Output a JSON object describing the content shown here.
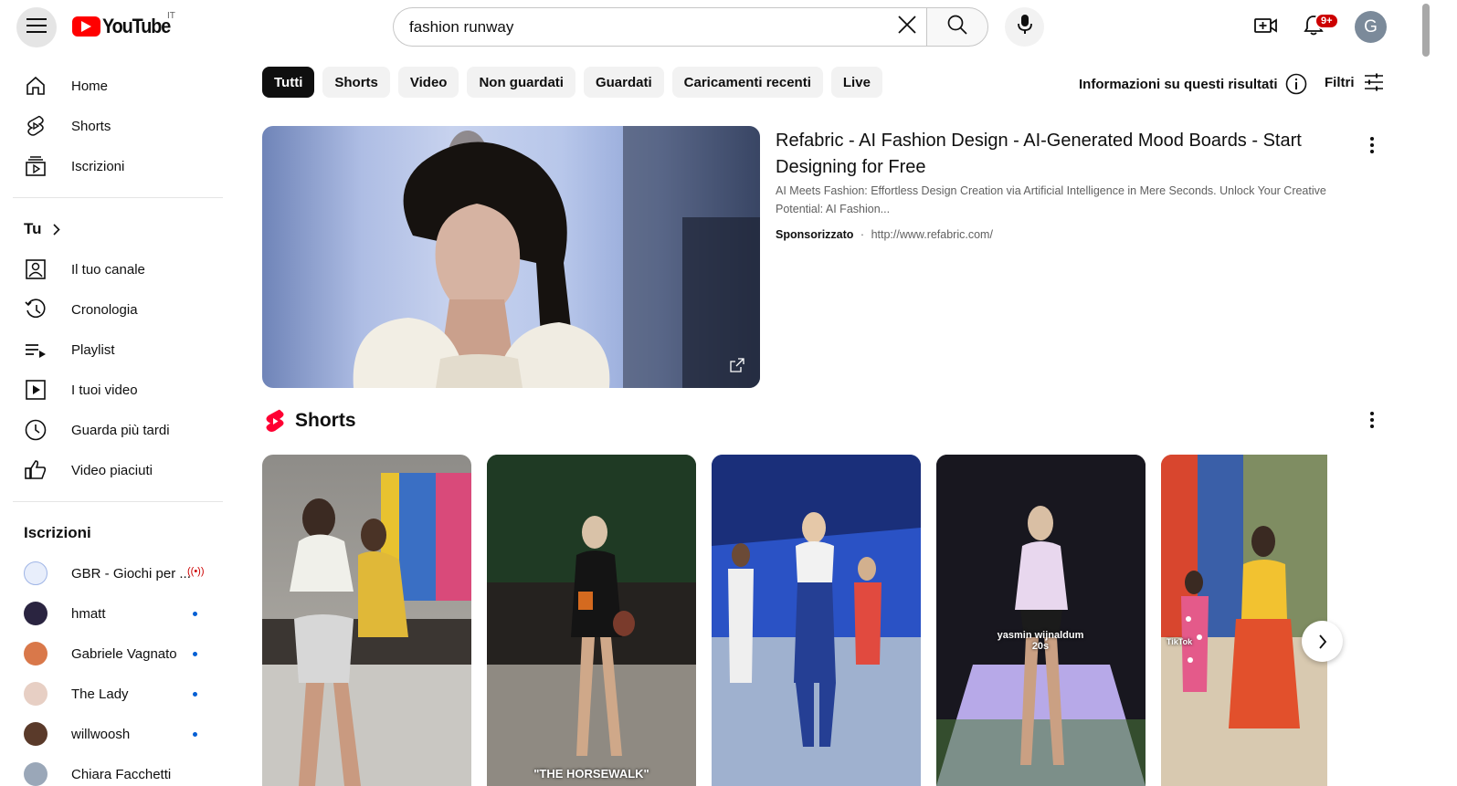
{
  "header": {
    "logo_text": "YouTube",
    "country_code": "IT",
    "search_value": "fashion runway",
    "notification_count": "9+",
    "avatar_letter": "G"
  },
  "sidebar": {
    "main": [
      {
        "label": "Home",
        "icon": "home-icon"
      },
      {
        "label": "Shorts",
        "icon": "shorts-icon"
      },
      {
        "label": "Iscrizioni",
        "icon": "subscriptions-icon"
      }
    ],
    "you_title": "Tu",
    "you_items": [
      {
        "label": "Il tuo canale",
        "icon": "channel-icon"
      },
      {
        "label": "Cronologia",
        "icon": "history-icon"
      },
      {
        "label": "Playlist",
        "icon": "playlist-icon"
      },
      {
        "label": "I tuoi video",
        "icon": "your-videos-icon"
      },
      {
        "label": "Guarda più tardi",
        "icon": "watch-later-icon"
      },
      {
        "label": "Video piaciuti",
        "icon": "like-icon"
      }
    ],
    "subs_title": "Iscrizioni",
    "subscriptions": [
      {
        "name": "GBR - Giochi per ...",
        "status": "live",
        "color": "#e8eefb"
      },
      {
        "name": "hmatt",
        "status": "new",
        "color": "#2a2440"
      },
      {
        "name": "Gabriele Vagnato",
        "status": "new",
        "color": "#d9784a"
      },
      {
        "name": "The Lady",
        "status": "new",
        "color": "#e7cfc4"
      },
      {
        "name": "willwoosh",
        "status": "new",
        "color": "#5a3a2a"
      },
      {
        "name": "Chiara Facchetti",
        "status": "",
        "color": "#9aa7b8"
      }
    ]
  },
  "chips": [
    "Tutti",
    "Shorts",
    "Video",
    "Non guardati",
    "Guardati",
    "Caricamenti recenti",
    "Live"
  ],
  "info_link": "Informazioni su questi risultati",
  "filters_label": "Filtri",
  "ad": {
    "title": "Refabric - AI Fashion Design - AI-Generated Mood Boards - Start Designing for Free",
    "description": "AI Meets Fashion: Effortless Design Creation via Artificial Intelligence in Mere Seconds. Unlock Your Creative Potential: AI Fashion...",
    "sponsored": "Sponsorizzato",
    "separator": "·",
    "url": "http://www.refabric.com/"
  },
  "shorts": {
    "title": "Shorts",
    "items": [
      {
        "caption": "",
        "bg": "#8d8a86"
      },
      {
        "caption": "\"THE HORSEWALK\"",
        "bg": "#3a3d2e"
      },
      {
        "caption": "",
        "bg": "#2b4fa8"
      },
      {
        "caption": "yasmin wijnaldum 20s",
        "bg": "#3d3a55"
      },
      {
        "caption": "TikTok",
        "bg": "#b65a3c"
      }
    ]
  }
}
